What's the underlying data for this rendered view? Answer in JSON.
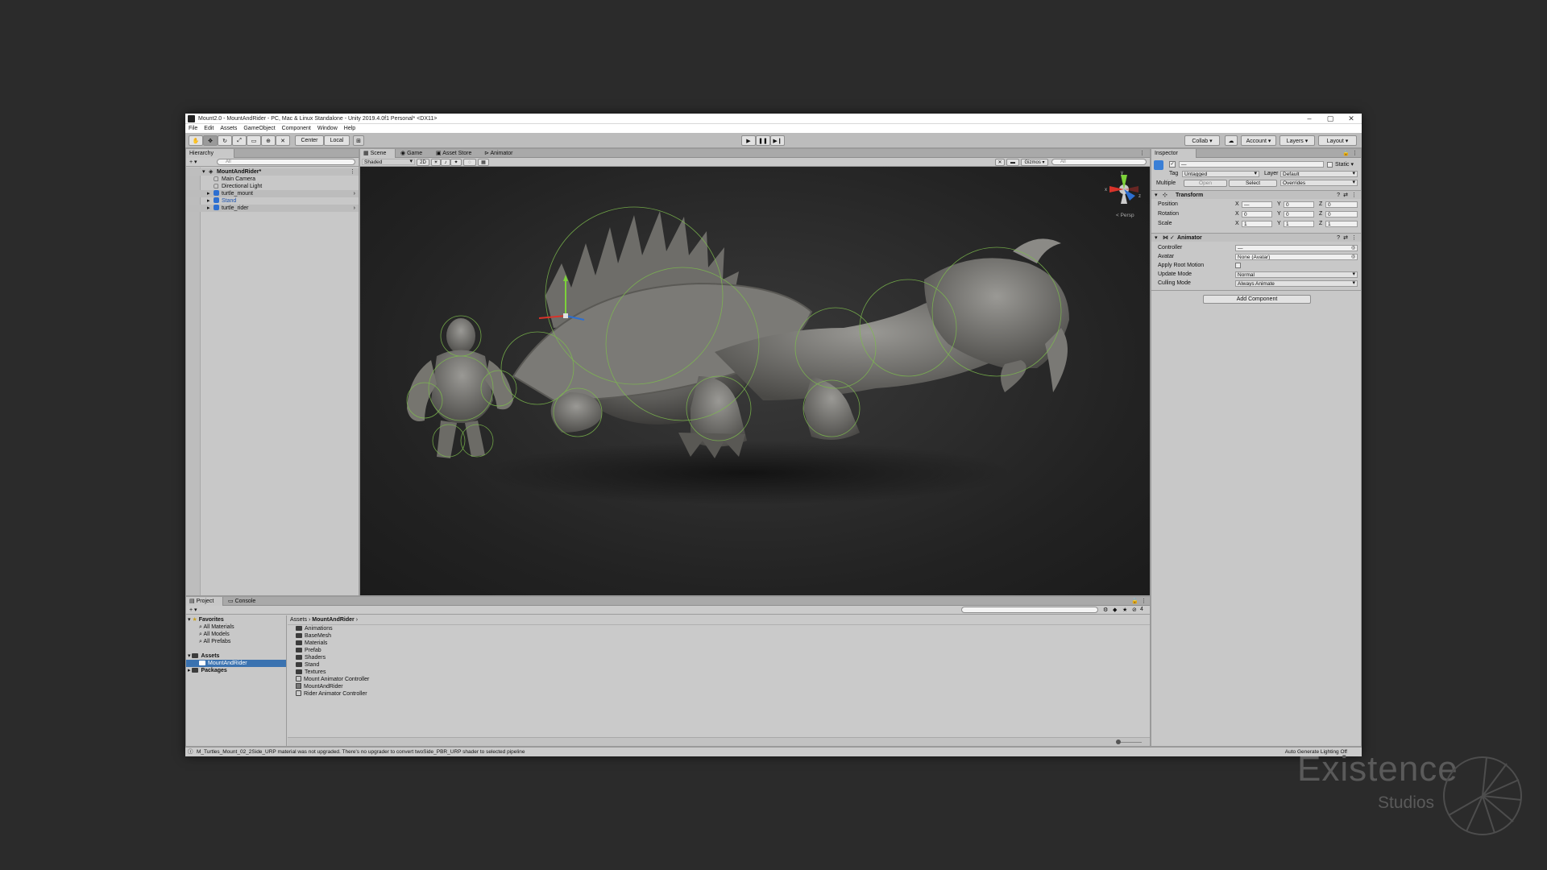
{
  "window": {
    "title": "Mount2.0 - MountAndRider - PC, Mac & Linux Standalone - Unity 2019.4.0f1 Personal* <DX11>",
    "min": "–",
    "max": "▢",
    "close": "✕"
  },
  "menu": [
    "File",
    "Edit",
    "Assets",
    "GameObject",
    "Component",
    "Window",
    "Help"
  ],
  "toolbar": {
    "pivot": "Center",
    "space": "Local",
    "collab": "Collab ▾",
    "account": "Account ▾",
    "layers": "Layers ▾",
    "layout": "Layout ▾",
    "play": "▶",
    "pause": "❚❚",
    "step": "▶❙"
  },
  "hierarchy": {
    "tab": "Hierarchy",
    "add": "+ ▾",
    "search": "All",
    "scene": "MountAndRider*",
    "items": [
      {
        "label": "Main Camera"
      },
      {
        "label": "Directional Light"
      },
      {
        "label": "turtle_mount"
      },
      {
        "label": "Stand"
      },
      {
        "label": "turtle_rider"
      }
    ]
  },
  "scene": {
    "tabs": [
      "Scene",
      "Game",
      "Asset Store",
      "Animator"
    ],
    "shading": "Shaded",
    "mode2d": "2D",
    "gizmos": "Gizmos ▾",
    "search": "All",
    "persp": "< Persp",
    "axes": {
      "x": "x",
      "y": "y",
      "z": "z"
    }
  },
  "inspector": {
    "tab": "Inspector",
    "name": "—",
    "static": "Static ▾",
    "tag_label": "Tag",
    "tag": "Untagged",
    "layer_label": "Layer",
    "layer": "Default",
    "multiple": "Multiple",
    "open": "Open",
    "select": "Select",
    "overrides": "Overrides",
    "transform": {
      "title": "Transform",
      "rows": [
        {
          "label": "Position",
          "x": "—",
          "y": "0",
          "z": "0"
        },
        {
          "label": "Rotation",
          "x": "0",
          "y": "0",
          "z": "0"
        },
        {
          "label": "Scale",
          "x": "1",
          "y": "1",
          "z": "1"
        }
      ]
    },
    "animator": {
      "title": "Animator",
      "controller_label": "Controller",
      "controller": "—",
      "avatar_label": "Avatar",
      "avatar": "None (Avatar)",
      "root_motion_label": "Apply Root Motion",
      "update_label": "Update Mode",
      "update": "Normal",
      "culling_label": "Culling Mode",
      "culling": "Always Animate"
    },
    "add_component": "Add Component"
  },
  "project": {
    "tabs": [
      "Project",
      "Console"
    ],
    "add": "+ ▾",
    "favorites": {
      "label": "Favorites",
      "items": [
        "All Materials",
        "All Models",
        "All Prefabs"
      ]
    },
    "assets_label": "Assets",
    "selected_folder": "MountAndRider",
    "packages": "Packages",
    "breadcrumb": [
      "Assets",
      "MountAndRider"
    ],
    "contents": [
      {
        "name": "Animations",
        "kind": "folder"
      },
      {
        "name": "BaseMesh",
        "kind": "folder"
      },
      {
        "name": "Materials",
        "kind": "folder"
      },
      {
        "name": "Prefab",
        "kind": "folder"
      },
      {
        "name": "Shaders",
        "kind": "folder"
      },
      {
        "name": "Stand",
        "kind": "folder"
      },
      {
        "name": "Textures",
        "kind": "folder"
      },
      {
        "name": "Mount Animator Controller",
        "kind": "animator"
      },
      {
        "name": "MountAndRider",
        "kind": "scene"
      },
      {
        "name": "Rider Animator Controller",
        "kind": "animator"
      }
    ],
    "hidden_count": "4"
  },
  "status": {
    "message": "M_Turtles_Mount_02_2Side_URP material was not upgraded. There's no upgrader to convert twoSide_PBR_URP shader to selected pipeline",
    "lighting": "Auto Generate Lighting Off"
  },
  "watermark": {
    "title": "Existence",
    "subtitle": "Studios"
  },
  "colors": {
    "selection": "#3a72b0",
    "scene_bg": "#222222",
    "gizmo_green": "#7dbb4d",
    "accent_blue": "#2d6fd1"
  }
}
